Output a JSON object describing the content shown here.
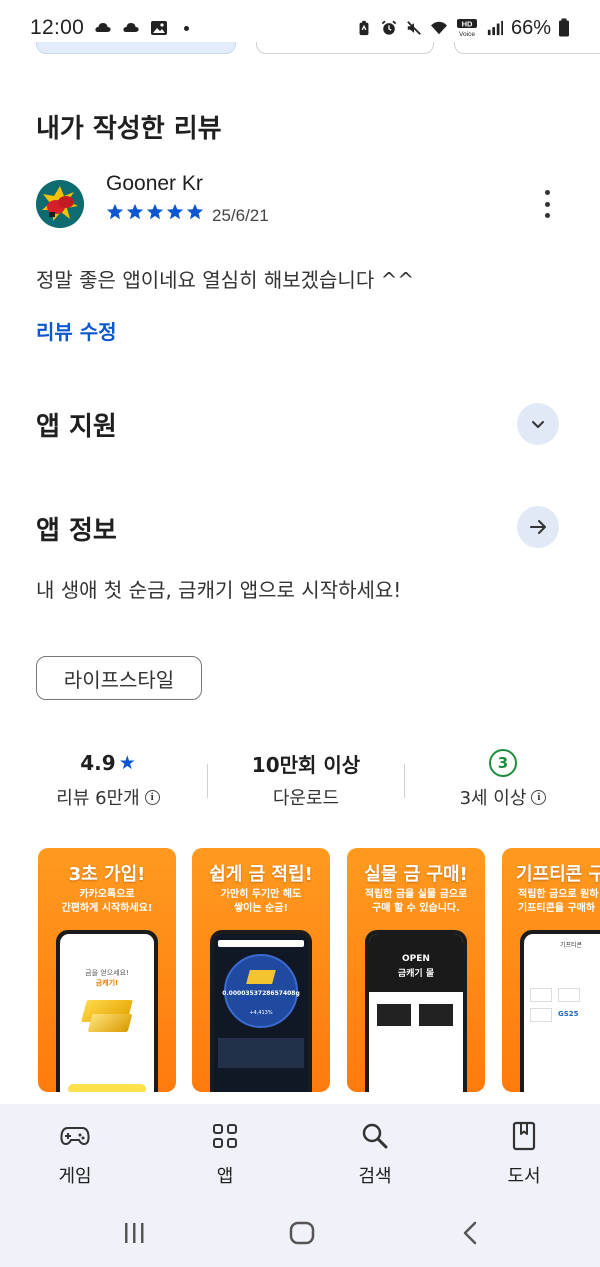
{
  "status_bar": {
    "time": "12:00",
    "left_icons": [
      "cloud-icon",
      "cloud-icon",
      "image-icon",
      "dot-icon"
    ],
    "right_icons": [
      "battery-saver-icon",
      "alarm-icon",
      "mute-icon",
      "wifi-icon",
      "hd-voice-icon",
      "signal-icon"
    ],
    "battery": "66%"
  },
  "my_review": {
    "title": "내가 작성한 리뷰",
    "reviewer": "Gooner Kr",
    "rating": 5,
    "date": "25/6/21",
    "text": "정말 좋은 앱이네요 열심히 해보겠습니다 ^^",
    "edit_label": "리뷰 수정"
  },
  "app_support": {
    "title": "앱 지원"
  },
  "app_info": {
    "title": "앱 정보",
    "description": "내 생애 첫 순금, 금캐기 앱으로 시작하세요!",
    "category": "라이프스타일"
  },
  "stats": {
    "rating": "4.9",
    "rating_star": "★",
    "reviews_label": "리뷰 6만개",
    "downloads": "10만회 이상",
    "downloads_label": "다운로드",
    "age": "3",
    "age_label": "3세 이상",
    "info_glyph": "i"
  },
  "screenshots": [
    {
      "title": "3초 가입!",
      "subtitle_1": "카카오톡으로",
      "subtitle_2": "간편하게 시작하세요!",
      "screen_text_1": "금을 얻으세요!",
      "screen_text_2": "금캐기!"
    },
    {
      "title": "쉽게 금 적립!",
      "subtitle_1": "가만히 두기만 해도",
      "subtitle_2": "쌓이는 순금!",
      "screen_text_1": "0.0000353728657408g",
      "screen_text_2": "+4,413%"
    },
    {
      "title": "실물 금 구매!",
      "subtitle_1": "적립한 금을 실물 금으로",
      "subtitle_2": "구매 할 수 있습니다.",
      "screen_text_1": "OPEN",
      "screen_text_2": "금캐기 몰"
    },
    {
      "title": "기프티콘 구",
      "subtitle_1": "적립한 금으로 원하",
      "subtitle_2": "기프티콘을 구매하",
      "screen_text_1": "기프티콘",
      "screen_text_2": "GS25"
    }
  ],
  "bottom_nav": [
    {
      "label": "게임",
      "icon": "gamepad-icon"
    },
    {
      "label": "앱",
      "icon": "apps-grid-icon"
    },
    {
      "label": "검색",
      "icon": "search-icon"
    },
    {
      "label": "도서",
      "icon": "book-icon"
    }
  ],
  "colors": {
    "accent_blue": "#0b57d0",
    "star_blue": "#0b57d0",
    "age_green": "#1e8e3e",
    "nav_background": "#eff2f8",
    "screenshot_orange": "#ff8a12"
  }
}
